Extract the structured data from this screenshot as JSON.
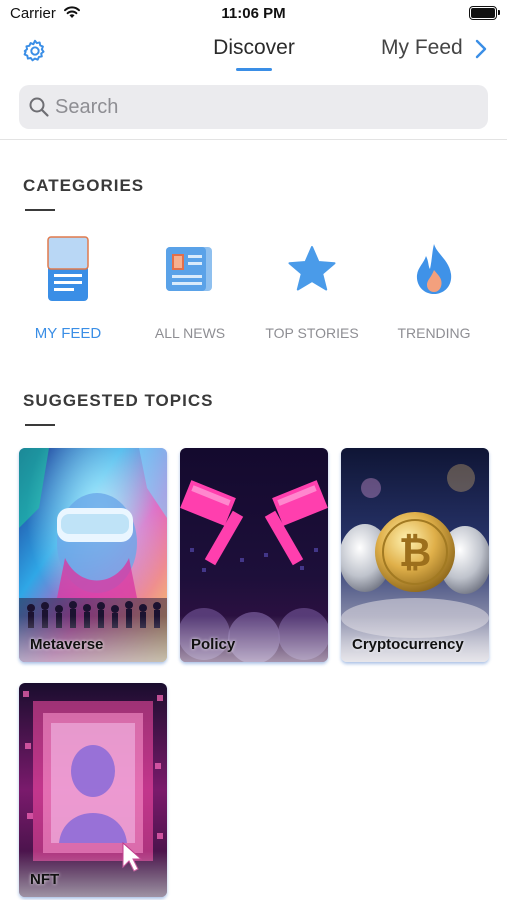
{
  "status_bar": {
    "carrier": "Carrier",
    "time": "11:06 PM"
  },
  "header": {
    "tabs": [
      {
        "label": "Discover",
        "active": true
      },
      {
        "label": "My Feed",
        "active": false
      }
    ],
    "accent_color": "#3a8ee6"
  },
  "search": {
    "placeholder": "Search",
    "value": ""
  },
  "categories": {
    "title": "CATEGORIES",
    "items": [
      {
        "label": "MY FEED",
        "icon": "phone-feed-icon",
        "active": true
      },
      {
        "label": "ALL NEWS",
        "icon": "newspaper-icon",
        "active": false
      },
      {
        "label": "TOP STORIES",
        "icon": "star-icon",
        "active": false
      },
      {
        "label": "TRENDING",
        "icon": "flame-icon",
        "active": false
      }
    ]
  },
  "suggested_topics": {
    "title": "SUGGESTED TOPICS",
    "items": [
      {
        "label": "Metaverse",
        "image": "vr-headset-crowd-image"
      },
      {
        "label": "Policy",
        "image": "neon-gavel-image"
      },
      {
        "label": "Cryptocurrency",
        "image": "crypto-coins-image"
      },
      {
        "label": "NFT",
        "image": "pixel-art-portrait-image"
      }
    ]
  }
}
